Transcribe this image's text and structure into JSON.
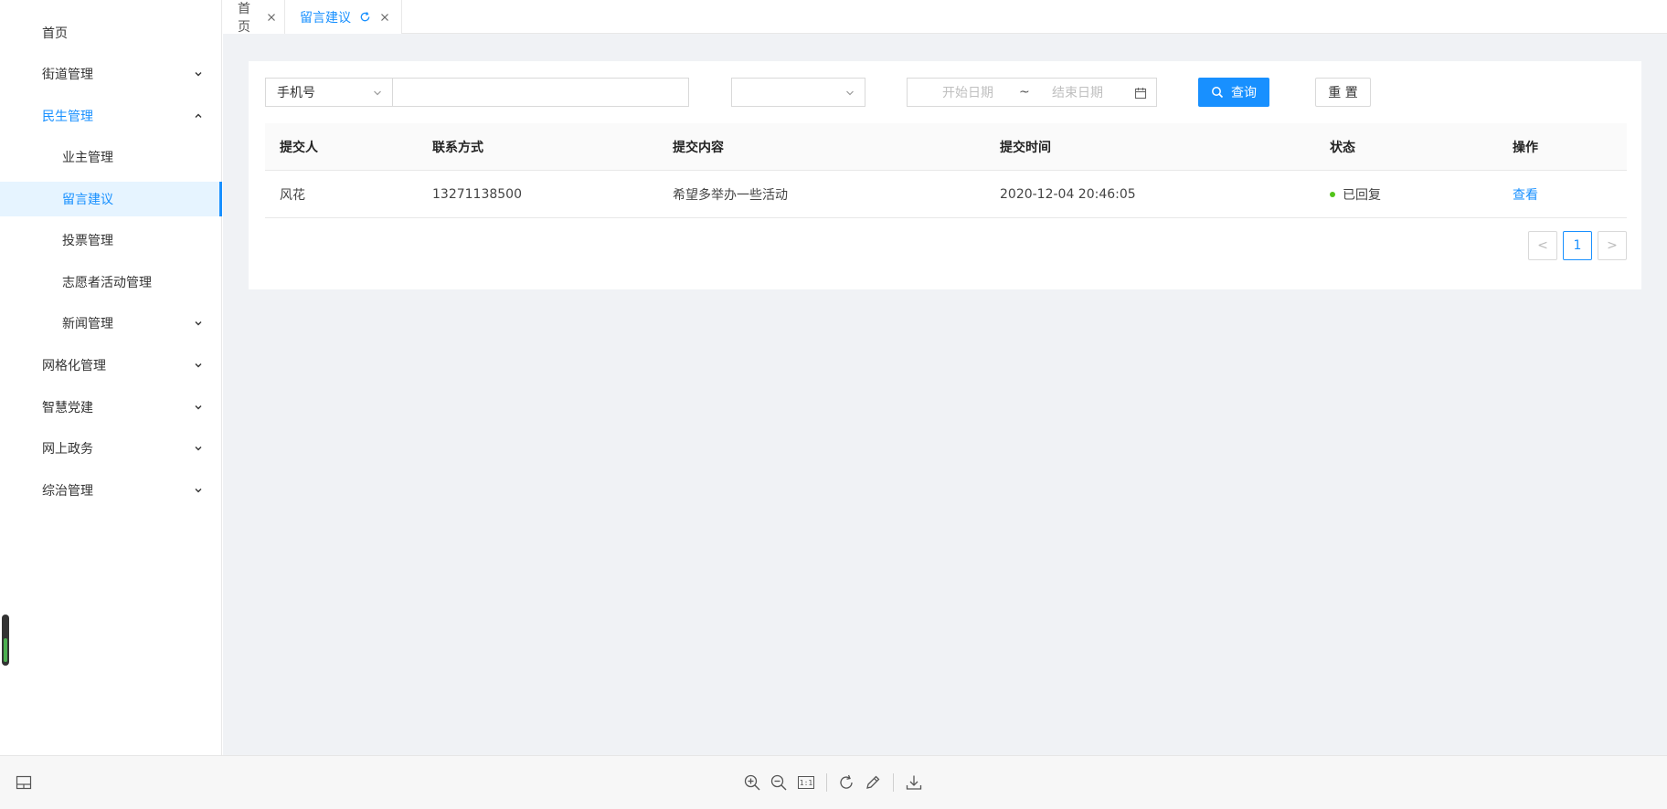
{
  "sidebar": {
    "items": [
      {
        "label": "首页"
      },
      {
        "label": "街道管理"
      },
      {
        "label": "民生管理"
      },
      {
        "label": "业主管理"
      },
      {
        "label": "留言建议"
      },
      {
        "label": "投票管理"
      },
      {
        "label": "志愿者活动管理"
      },
      {
        "label": "新闻管理"
      },
      {
        "label": "网格化管理"
      },
      {
        "label": "智慧党建"
      },
      {
        "label": "网上政务"
      },
      {
        "label": "综治管理"
      }
    ]
  },
  "tabs": [
    {
      "label": "首页"
    },
    {
      "label": "留言建议"
    }
  ],
  "filter": {
    "field_select": "手机号",
    "search_value": "",
    "status_select": "",
    "date_start_placeholder": "开始日期",
    "date_separator": "~",
    "date_end_placeholder": "结束日期",
    "query_label": "查询",
    "reset_label": "重 置"
  },
  "table": {
    "columns": [
      "提交人",
      "联系方式",
      "提交内容",
      "提交时间",
      "状态",
      "操作"
    ],
    "rows": [
      {
        "submitter": "风花",
        "contact": "13271138500",
        "content": "希望多举办一些活动",
        "time": "2020-12-04 20:46:05",
        "status": "已回复",
        "action": "查看"
      }
    ]
  },
  "pagination": {
    "current_page": "1",
    "prev": "<",
    "next": ">"
  },
  "viewer_toolbar": {
    "zoom_reset_label": "1:1"
  },
  "colors": {
    "accent": "#1890ff",
    "status_replied": "#52c41a",
    "content_bg": "#f0f2f5"
  }
}
